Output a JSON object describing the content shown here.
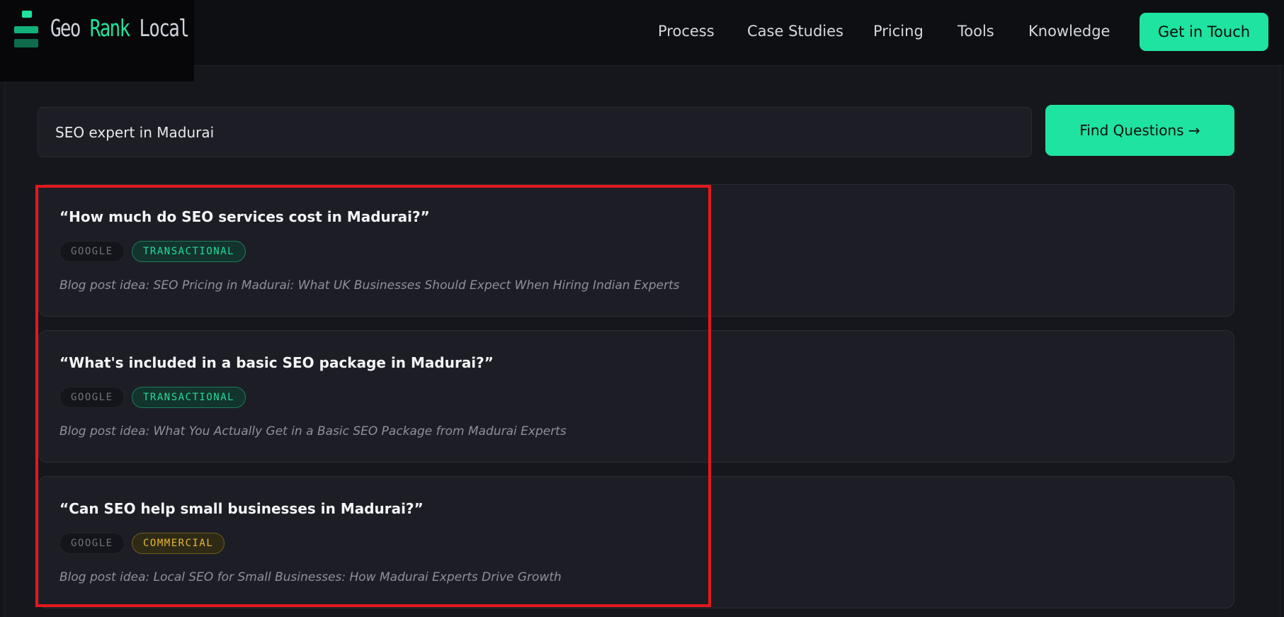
{
  "brand": {
    "name_part1": "Geo ",
    "name_part2": "Rank",
    "name_part3": " Local",
    "accent_color": "#1fe3a0"
  },
  "nav": {
    "items": [
      "Process",
      "Case Studies",
      "Pricing",
      "Tools",
      "Knowledge"
    ],
    "cta_label": "Get in Touch"
  },
  "search": {
    "value": "SEO expert in Madurai",
    "button_label": "Find Questions →"
  },
  "questions": [
    {
      "question": "“How much do SEO services cost in Madurai?”",
      "source": "GOOGLE",
      "intent": "TRANSACTIONAL",
      "idea": "Blog post idea: SEO Pricing in Madurai: What UK Businesses Should Expect When Hiring Indian Experts"
    },
    {
      "question": "“What's included in a basic SEO package in Madurai?”",
      "source": "GOOGLE",
      "intent": "TRANSACTIONAL",
      "idea": "Blog post idea: What You Actually Get in a Basic SEO Package from Madurai Experts"
    },
    {
      "question": "“Can SEO help small businesses in Madurai?”",
      "source": "GOOGLE",
      "intent": "COMMERCIAL",
      "idea": "Blog post idea: Local SEO for Small Businesses: How Madurai Experts Drive Growth"
    }
  ],
  "colors": {
    "transactional": "#26d99c",
    "commercial": "#e9b733",
    "highlight": "#e4171b"
  }
}
